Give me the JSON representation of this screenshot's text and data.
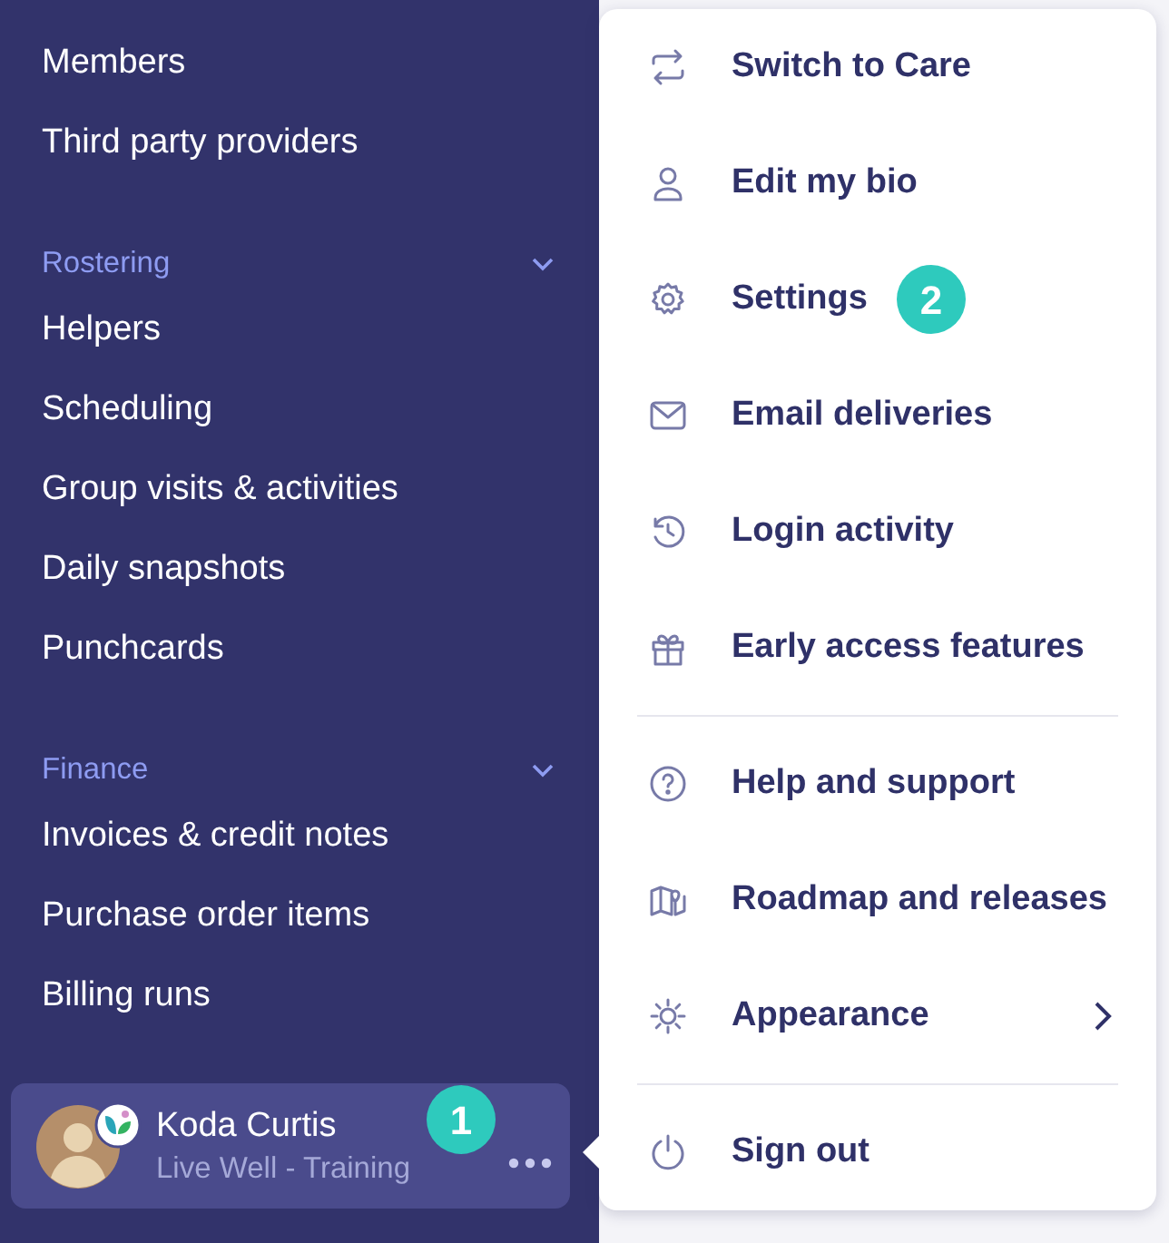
{
  "sidebar": {
    "sections": [
      {
        "items": [
          "Members",
          "Third party providers"
        ]
      },
      {
        "title": "Rostering",
        "expanded": true,
        "items": [
          "Helpers",
          "Scheduling",
          "Group visits & activities",
          "Daily snapshots",
          "Punchcards"
        ]
      },
      {
        "title": "Finance",
        "expanded": true,
        "items": [
          "Invoices & credit notes",
          "Purchase order items",
          "Billing runs"
        ]
      }
    ]
  },
  "user": {
    "name": "Koda Curtis",
    "organisation": "Live Well - Training",
    "step_marker": "1"
  },
  "menu": {
    "groups": [
      [
        {
          "label": "Switch to Care"
        },
        {
          "label": "Edit my bio"
        },
        {
          "label": "Settings",
          "step_marker": "2"
        },
        {
          "label": "Email deliveries"
        },
        {
          "label": "Login activity"
        },
        {
          "label": "Early access features"
        }
      ],
      [
        {
          "label": "Help and support"
        },
        {
          "label": "Roadmap and releases"
        },
        {
          "label": "Appearance",
          "submenu": true
        }
      ],
      [
        {
          "label": "Sign out"
        }
      ]
    ]
  }
}
